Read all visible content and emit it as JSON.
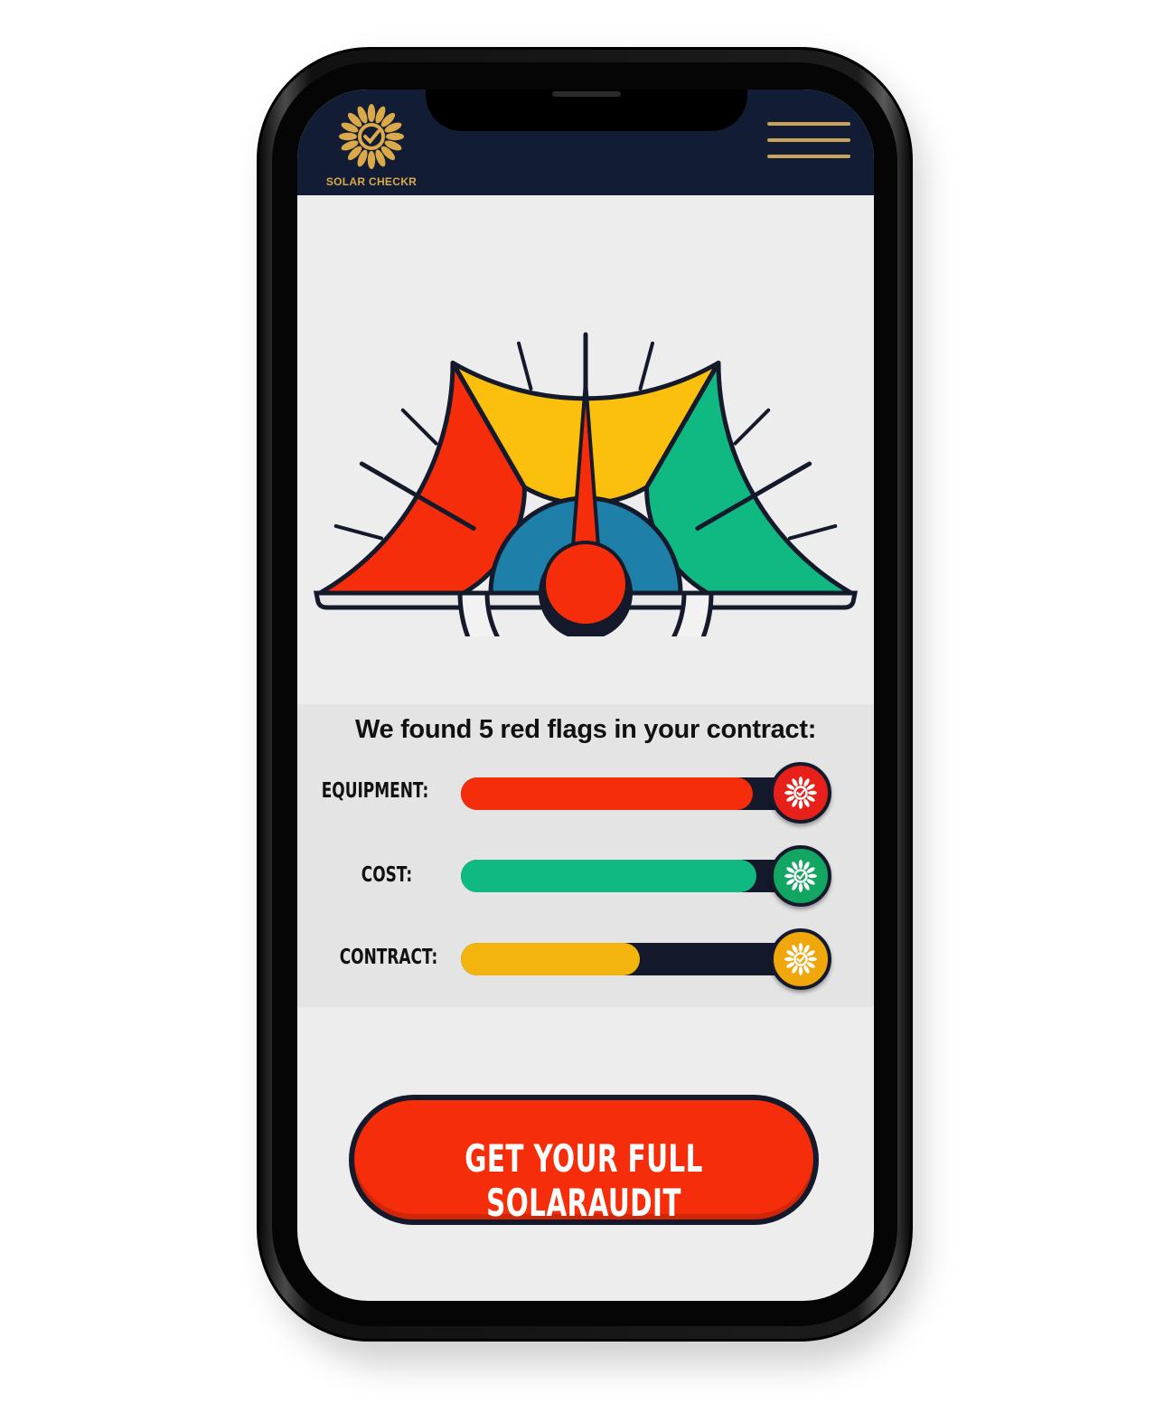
{
  "app": {
    "logo_text": "SOLAR CHECKR",
    "brand_color": "#d9a94a",
    "header_color": "#131c35",
    "menu_icon": "hamburger-menu-icon"
  },
  "gauge": {
    "zones": [
      {
        "name": "red",
        "color": "#f52d0a"
      },
      {
        "name": "yellow",
        "color": "#fbbf0e"
      },
      {
        "name": "green",
        "color": "#10b981"
      }
    ],
    "needle_fraction": 0.5
  },
  "results": {
    "headline": "We found 5 red flags in your contract:",
    "categories": [
      {
        "label": "EQUIPMENT:",
        "fill": 0.85,
        "color": "#f52d0a",
        "icon": "sun-check-icon"
      },
      {
        "label": "COST:",
        "fill": 0.86,
        "color": "#10b981",
        "icon": "sun-check-icon"
      },
      {
        "label": "CONTRACT:",
        "fill": 0.52,
        "color": "#f2b40d",
        "icon": "sun-check-icon"
      }
    ]
  },
  "cta": {
    "label": "GET YOUR FULL SOLARAUDIT",
    "color": "#f52d0a"
  }
}
